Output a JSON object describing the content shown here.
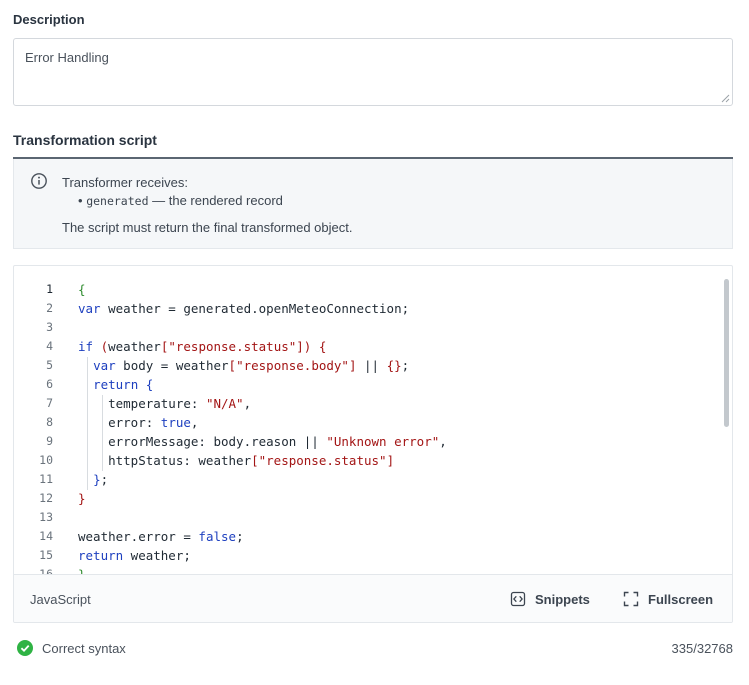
{
  "description": {
    "label": "Description",
    "value": "Error Handling"
  },
  "transformation": {
    "title": "Transformation script",
    "info": {
      "line1": "Transformer receives:",
      "bullet": "•",
      "param_name": "generated",
      "param_desc": " — the rendered record",
      "line3": "The script must return the final transformed object."
    }
  },
  "editor": {
    "line_numbers": [
      "1",
      "2",
      "3",
      "4",
      "5",
      "6",
      "7",
      "8",
      "9",
      "10",
      "11",
      "12",
      "13",
      "14",
      "15",
      "16"
    ],
    "language": "JavaScript",
    "snippets_label": "Snippets",
    "fullscreen_label": "Fullscreen"
  },
  "status": {
    "syntax_text": "Correct syntax",
    "char_count": "335/32768",
    "ok_color": "#2fb344"
  },
  "icons": [
    "info-icon",
    "code-icon",
    "fullscreen-icon",
    "check-circle-icon"
  ]
}
